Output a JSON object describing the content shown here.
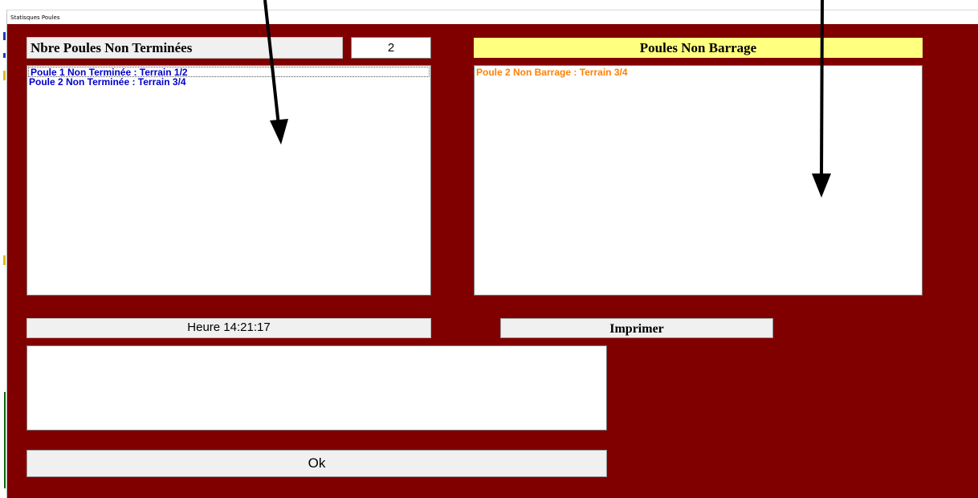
{
  "window": {
    "title": "Statisques Poules"
  },
  "unfinished": {
    "label": "Nbre Poules Non Terminées",
    "count": "2",
    "items": [
      "Poule 1 Non Terminée : Terrain 1/2",
      "Poule 2 Non Terminée : Terrain 3/4"
    ],
    "color": "#0000cc"
  },
  "non_barrage": {
    "label": "Poules Non Barrage",
    "items": [
      "Poule 2 Non Barrage : Terrain 3/4"
    ],
    "color": "#ff8000",
    "header_color": "#ffff80"
  },
  "clock": {
    "text": "Heure 14:21:17"
  },
  "print_button": {
    "label": "Imprimer"
  },
  "ok_button": {
    "label": "Ok"
  },
  "colors": {
    "background": "#800000"
  }
}
